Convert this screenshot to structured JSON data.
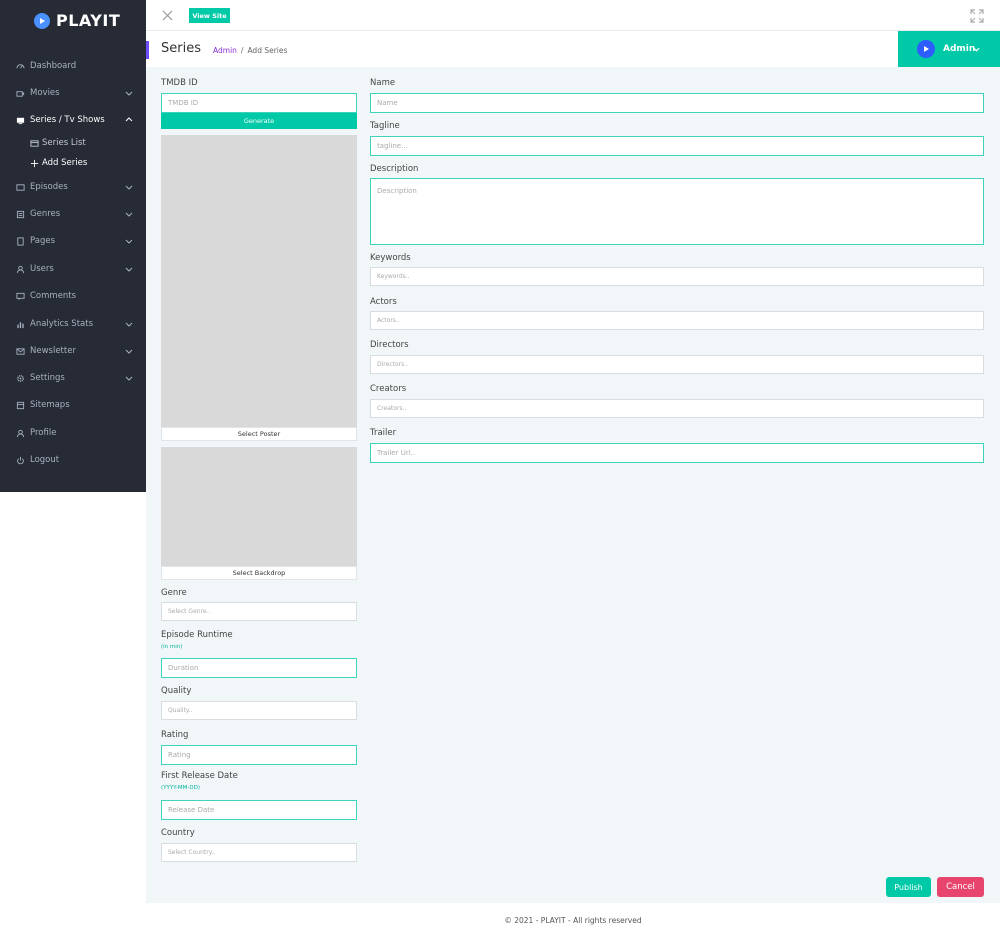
{
  "brand": {
    "name": "PLAYIT"
  },
  "sidebar": {
    "items": [
      {
        "label": "Dashboard",
        "icon": "dashboard-icon"
      },
      {
        "label": "Movies",
        "icon": "movie-icon"
      },
      {
        "label": "Series / Tv Shows",
        "icon": "tv-icon"
      },
      {
        "label": "Episodes",
        "icon": "episode-icon"
      },
      {
        "label": "Genres",
        "icon": "genre-icon"
      },
      {
        "label": "Pages",
        "icon": "page-icon"
      },
      {
        "label": "Users",
        "icon": "user-icon"
      },
      {
        "label": "Comments",
        "icon": "comment-icon"
      },
      {
        "label": "Analytics Stats",
        "icon": "chart-icon"
      },
      {
        "label": "Newsletter",
        "icon": "mail-icon"
      },
      {
        "label": "Settings",
        "icon": "gear-icon"
      },
      {
        "label": "Sitemaps",
        "icon": "sitemap-icon"
      },
      {
        "label": "Profile",
        "icon": "profile-icon"
      },
      {
        "label": "Logout",
        "icon": "power-icon"
      }
    ],
    "sub_items": [
      {
        "label": "Series List",
        "icon": "list-icon"
      },
      {
        "label": "Add Series",
        "icon": "plus-icon"
      }
    ]
  },
  "topbar": {
    "view_site": "View Site"
  },
  "header": {
    "title": "Series",
    "breadcrumb_root": "Admin",
    "breadcrumb_sep": "/",
    "breadcrumb_current": "Add Series",
    "user": "Admin"
  },
  "form": {
    "tmdb": {
      "label": "TMDB ID",
      "placeholder": "TMDB ID",
      "button": "Generate"
    },
    "poster_button": "Select Poster",
    "backdrop_button": "Select Backdrop",
    "genre": {
      "label": "Genre",
      "placeholder": "Select Genre.."
    },
    "runtime": {
      "label": "Episode Runtime",
      "hint": "(in min)",
      "placeholder": "Duration"
    },
    "quality": {
      "label": "Quality",
      "placeholder": "Quality.."
    },
    "rating": {
      "label": "Rating",
      "placeholder": "Rating"
    },
    "release": {
      "label": "First Release Date",
      "hint": "(YYYY-MM-DD)",
      "placeholder": "Release Date"
    },
    "country": {
      "label": "Country",
      "placeholder": "Select Country.."
    },
    "name": {
      "label": "Name",
      "placeholder": "Name"
    },
    "tagline": {
      "label": "Tagline",
      "placeholder": "tagline..."
    },
    "description": {
      "label": "Description",
      "placeholder": "Description"
    },
    "keywords": {
      "label": "Keywords",
      "placeholder": "Keywords.."
    },
    "actors": {
      "label": "Actors",
      "placeholder": "Actors.."
    },
    "directors": {
      "label": "Directors",
      "placeholder": "Directors.."
    },
    "creators": {
      "label": "Creators",
      "placeholder": "Creators.."
    },
    "trailer": {
      "label": "Trailer",
      "placeholder": "Trailer Url.."
    },
    "publish": "Publish",
    "cancel": "Cancel"
  },
  "footer": {
    "text": "© 2021 - PLAYIT - All rights reserved"
  },
  "colors": {
    "accent": "#00c9a7",
    "sidebar": "#262b36",
    "danger": "#e8456e",
    "brand_purple": "#8a30d9"
  }
}
